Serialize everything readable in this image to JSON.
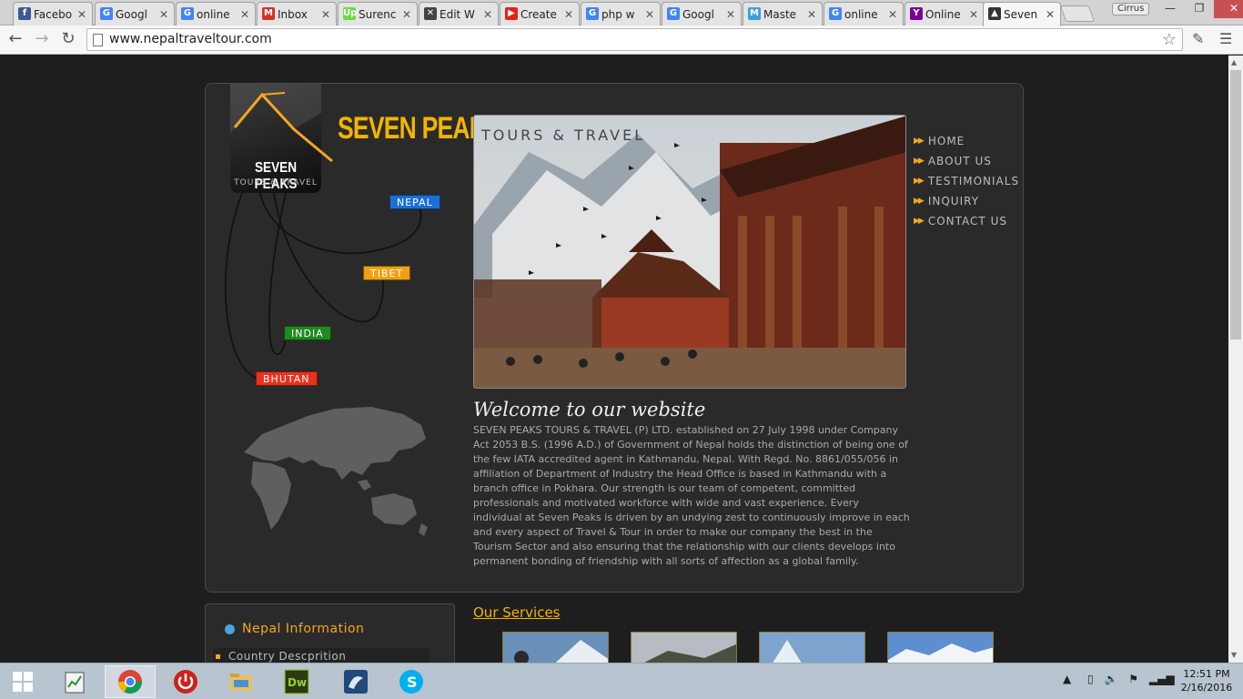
{
  "browser": {
    "tabs": [
      {
        "label": "Facebo",
        "icon": "facebook-icon",
        "color": "#3b5998",
        "glyph": "f"
      },
      {
        "label": "Googl",
        "icon": "google-icon",
        "color": "#4285f4",
        "glyph": "G"
      },
      {
        "label": "online",
        "icon": "google-icon",
        "color": "#4285f4",
        "glyph": "G"
      },
      {
        "label": "Inbox",
        "icon": "gmail-icon",
        "color": "#d93025",
        "glyph": "M"
      },
      {
        "label": "Surenc",
        "icon": "upwork-icon",
        "color": "#6fda44",
        "glyph": "Up"
      },
      {
        "label": "Edit W",
        "icon": "tools-icon",
        "color": "#444444",
        "glyph": "✕"
      },
      {
        "label": "Create",
        "icon": "youtube-icon",
        "color": "#e62117",
        "glyph": "▶"
      },
      {
        "label": "php w",
        "icon": "google-icon",
        "color": "#4285f4",
        "glyph": "G"
      },
      {
        "label": "Googl",
        "icon": "google-icon",
        "color": "#4285f4",
        "glyph": "G"
      },
      {
        "label": "Maste",
        "icon": "site-icon",
        "color": "#3aa0d8",
        "glyph": "M"
      },
      {
        "label": "online",
        "icon": "google-icon",
        "color": "#4285f4",
        "glyph": "G"
      },
      {
        "label": "Online",
        "icon": "yahoo-icon",
        "color": "#7b0099",
        "glyph": "Y"
      },
      {
        "label": "Seven",
        "icon": "seven-peaks-icon",
        "color": "#333333",
        "glyph": "▲"
      }
    ],
    "active_tab": 12,
    "user": "Cirrus",
    "url": "www.nepaltraveltour.com"
  },
  "site": {
    "logo_line1": "SEVEN PEAKS",
    "logo_line2": "TOURS & TRAVEL",
    "title": "SEVEN PEAKS",
    "hero_caption": "TOURS & TRAVEL",
    "countries": [
      {
        "label": "NEPAL",
        "color": "#1a6fd6"
      },
      {
        "label": "TIBET",
        "color": "#f0a010"
      },
      {
        "label": "INDIA",
        "color": "#1f8a1f"
      },
      {
        "label": "BHUTAN",
        "color": "#e8321e"
      }
    ],
    "nav": [
      "HOME",
      "ABOUT US",
      "TESTIMONIALS",
      "INQUIRY",
      "CONTACT US"
    ],
    "welcome_title": "Welcome to our website",
    "welcome_body": "SEVEN PEAKS TOURS & TRAVEL (P) LTD. established on 27 July 1998 under Company Act 2053 B.S. (1996 A.D.) of Government of Nepal holds the distinction of being one of the few IATA accredited agent in Kathmandu, Nepal. With Regd. No. 8861/055/056 in affiliation of Department of Industry the Head Office is based in Kathmandu with a branch office in Pokhara. Our strength is our team of competent, committed professionals and motivated workforce with wide and vast experience. Every individual at Seven Peaks is driven by an undying zest to continuously improve in each and every aspect of Travel & Tour in order to make our company the best in the Tourism Sector and also ensuring that the relationship with our clients develops into permanent bonding of friendship with all sorts of affection as a global family.",
    "info_title": "Nepal Information",
    "info_items": [
      "Country Descprition"
    ],
    "services_title": "Our Services"
  },
  "taskbar": {
    "time": "12:51 PM",
    "date": "2/16/2016"
  },
  "colors": {
    "accent": "#f5b400",
    "orange": "#f5a623"
  }
}
